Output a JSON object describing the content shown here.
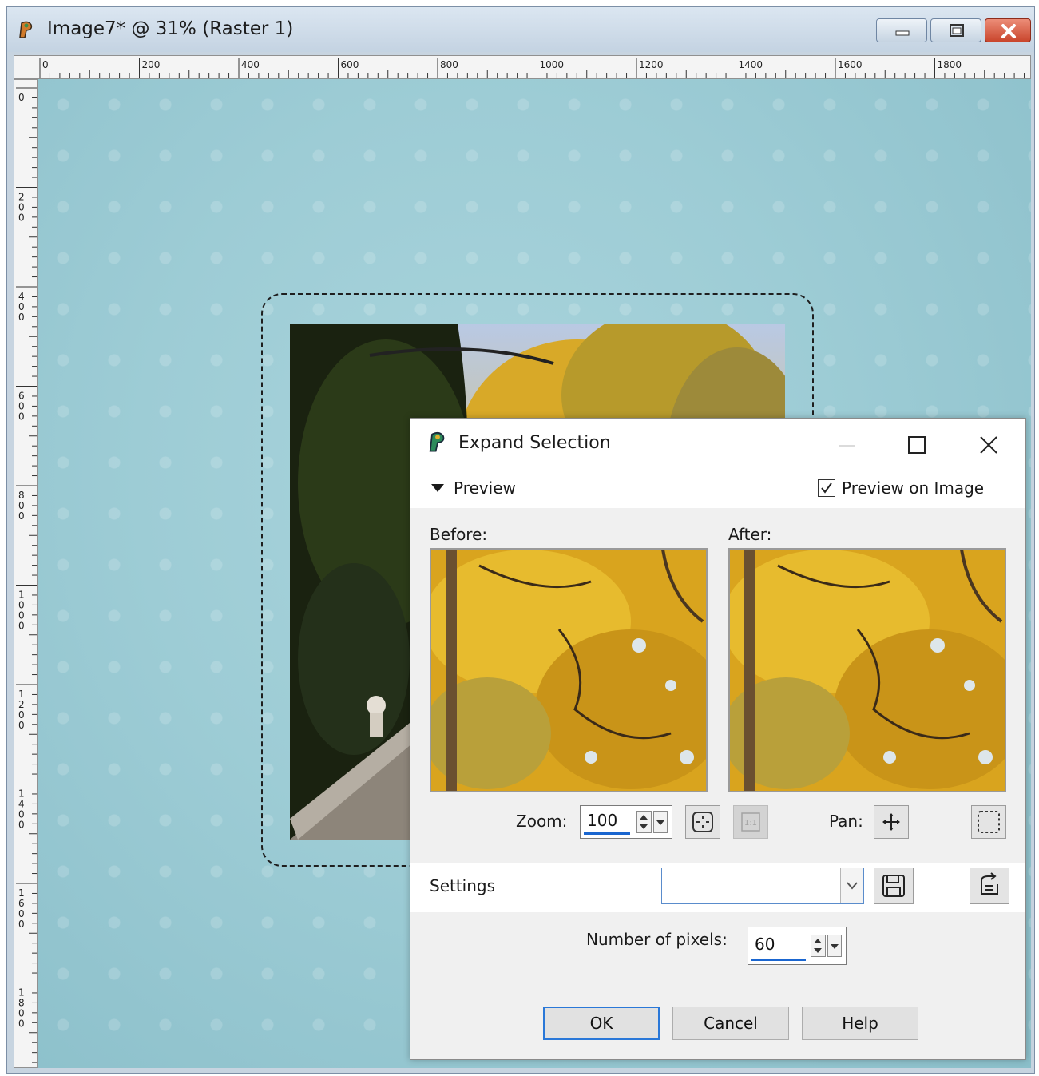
{
  "window": {
    "title": "Image7* @  31% (Raster 1)"
  },
  "ruler": {
    "horizontal_labels": [
      "0",
      "200",
      "400",
      "600",
      "800",
      "1000",
      "1200",
      "1400",
      "1600",
      "1800"
    ],
    "vertical_labels": [
      "0",
      "200",
      "400",
      "600",
      "800",
      "1000",
      "1200",
      "1400",
      "1600",
      "1800"
    ]
  },
  "dialog": {
    "title": "Expand Selection",
    "preview_toggle": "Preview",
    "preview_on_image": "Preview on Image",
    "preview_on_image_checked": true,
    "before_label": "Before:",
    "after_label": "After:",
    "zoom_label": "Zoom:",
    "zoom_value": "100",
    "pan_label": "Pan:",
    "settings_label": "Settings",
    "settings_value": "",
    "pixels_label": "Number of pixels:",
    "pixels_value": "60",
    "ok": "OK",
    "cancel": "Cancel",
    "help": "Help"
  },
  "colors": {
    "canvas": "#9dccd5",
    "titlebar": "#c7d4e0",
    "close_button": "#c9452c",
    "focus_blue": "#2a78d8"
  },
  "icons": {
    "app": "psp-icon",
    "minimize": "minimize-icon",
    "maximize": "maximize-icon",
    "close": "close-icon",
    "pan": "move-icon",
    "settings_save": "save-icon",
    "settings_reset": "reset-icon"
  }
}
